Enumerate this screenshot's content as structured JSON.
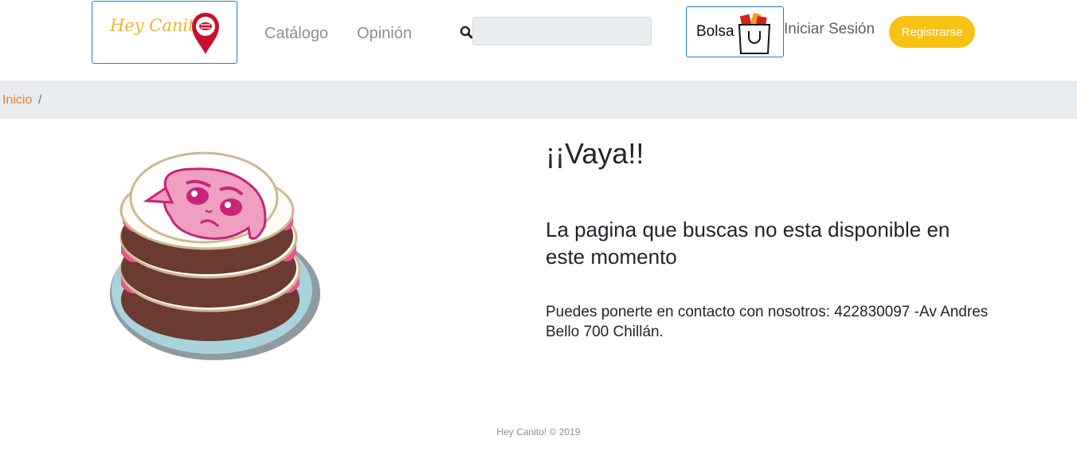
{
  "header": {
    "logo_text": "Hey Canito!",
    "nav": [
      {
        "label": "Catálogo"
      },
      {
        "label": "Opinión"
      }
    ],
    "search": {
      "value": "",
      "placeholder": ""
    },
    "bag_label": "Bolsa",
    "login_label": "Iniciar Sesión",
    "register_label": "Registrarse"
  },
  "breadcrumb": {
    "home": "Inicio",
    "separator": "/"
  },
  "main": {
    "title": "¡¡Vaya!!",
    "subtitle": "La pagina que buscas no esta disponible en este momento",
    "contact": "Puedes ponerte en contacto con nosotros: 422830097 -Av Andres Bello 700 Chillán."
  },
  "footer": {
    "text": "Hey Canito! © 2019"
  },
  "colors": {
    "accent_yellow": "#f8c115",
    "link_orange": "#f07f1e",
    "border_blue": "#1c7fc7",
    "logo_red": "#c8102e",
    "cake_pink": "#e5568f",
    "cake_brown": "#6b3a30"
  },
  "icons": {
    "logo": "map-pin-icon",
    "search": "search-icon",
    "bag": "shopping-bag-icon",
    "illustration": "sad-cake-illustration"
  }
}
